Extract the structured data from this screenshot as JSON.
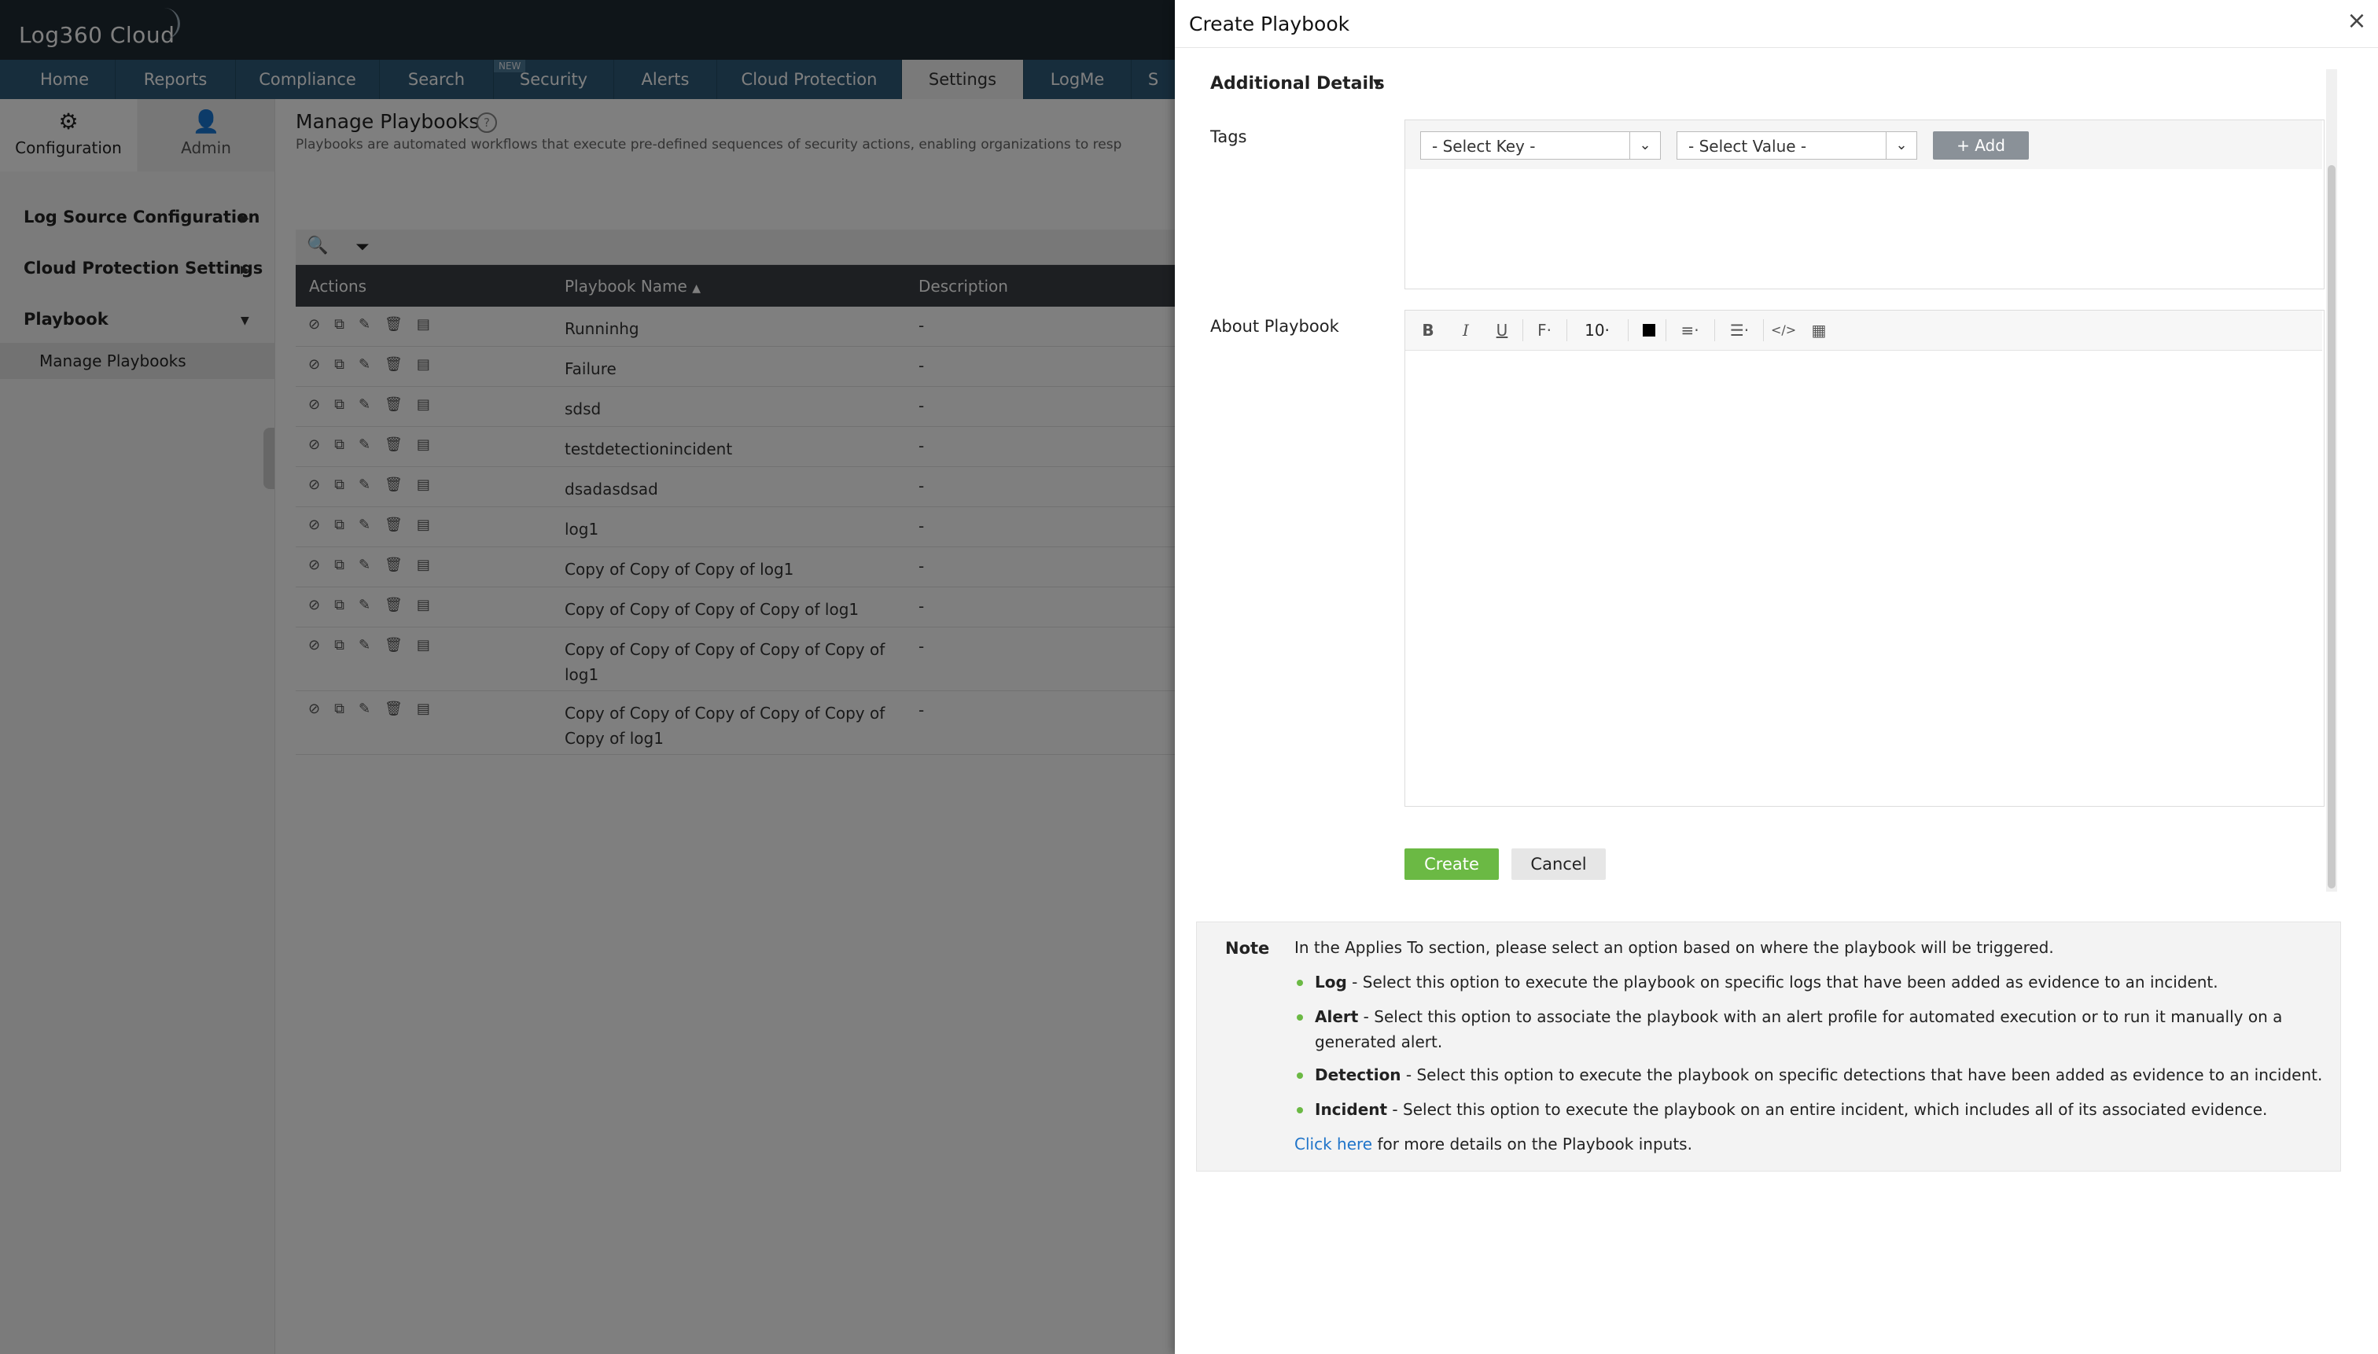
{
  "app": {
    "logo": "Log360 Cloud",
    "nav_tabs": [
      "Home",
      "Reports",
      "Compliance",
      "Search",
      "Security",
      "Alerts",
      "Cloud Protection",
      "Settings",
      "LogMe",
      "S"
    ],
    "nav_new_badge": "NEW",
    "active_tab": "Settings",
    "sidebar_tabs": {
      "configuration": "Configuration",
      "admin": "Admin"
    },
    "sidebar_items": [
      "Log Source Configuration",
      "Cloud Protection Settings",
      "Playbook"
    ],
    "sidebar_active_item": "Manage Playbooks",
    "page_title": "Manage Playbooks",
    "page_description": "Playbooks are automated workflows that execute pre-defined sequences of security actions, enabling organizations to resp",
    "table": {
      "headers": {
        "actions": "Actions",
        "name": "Playbook Name",
        "description": "Description"
      },
      "rows": [
        {
          "name": "Runninhg",
          "description": "-"
        },
        {
          "name": "Failure",
          "description": "-"
        },
        {
          "name": "sdsd",
          "description": "-"
        },
        {
          "name": "testdetectionincident",
          "description": "-"
        },
        {
          "name": "dsadasdsad",
          "description": "-"
        },
        {
          "name": "log1",
          "description": "-"
        },
        {
          "name": "Copy of Copy of Copy of log1",
          "description": "-"
        },
        {
          "name": "Copy of Copy of Copy of Copy of log1",
          "description": "-"
        },
        {
          "name": "Copy of Copy of Copy of Copy of Copy of\nlog1",
          "description": "-"
        },
        {
          "name": "Copy of Copy of Copy of Copy of Copy of\nCopy of log1",
          "description": "-"
        }
      ]
    }
  },
  "drawer": {
    "title": "Create Playbook",
    "section_title": "Additional Details",
    "tags_label": "Tags",
    "key_select": "- Select Key -",
    "value_select": "- Select Value -",
    "add_label": "Add",
    "about_label": "About Playbook",
    "editor": {
      "font_size": "10"
    },
    "create_label": "Create",
    "cancel_label": "Cancel",
    "note": {
      "label": "Note",
      "intro": "In the Applies To section, please select an option based on where the playbook will be triggered.",
      "items": [
        {
          "term": "Log",
          "text": " - Select this option to execute the playbook on specific logs that have been added as evidence to an incident."
        },
        {
          "term": "Alert",
          "text": " - Select this option to associate the playbook with an alert profile for automated execution or to run it manually on a generated alert."
        },
        {
          "term": "Detection",
          "text": " - Select this option to execute the playbook on specific detections that have been added as evidence to an incident."
        },
        {
          "term": "Incident",
          "text": " - Select this option to execute the playbook on an entire incident, which includes all of its associated evidence."
        }
      ],
      "link_text": "Click here",
      "link_suffix": " for more details on the Playbook inputs."
    }
  },
  "colors": {
    "accent_green": "#6bb944",
    "nav_blue": "#2e5a78",
    "link_blue": "#1f74c9"
  }
}
